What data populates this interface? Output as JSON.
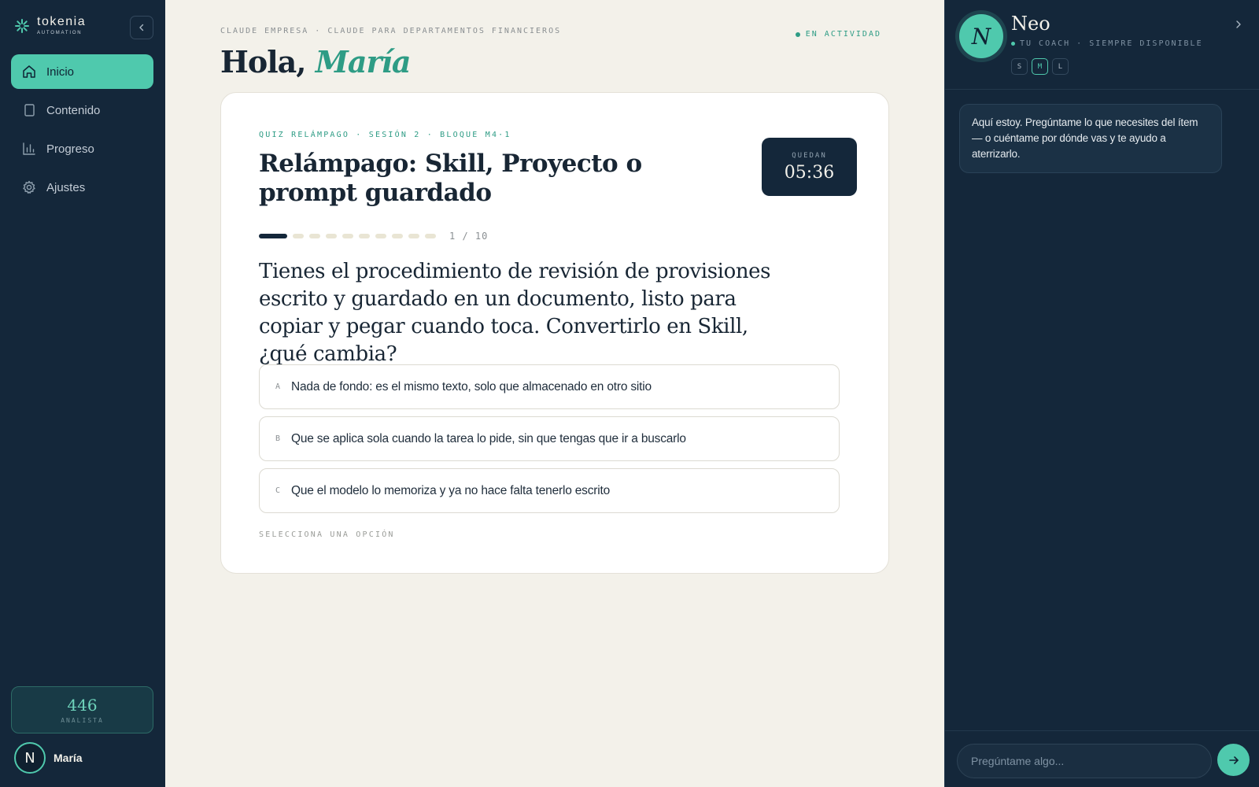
{
  "brand": {
    "name": "tokenia",
    "tagline": "AUTOMATION"
  },
  "sidebar": {
    "items": [
      {
        "label": "Inicio",
        "icon": "home-icon",
        "active": true
      },
      {
        "label": "Contenido",
        "icon": "document-icon"
      },
      {
        "label": "Progreso",
        "icon": "bar-chart-icon"
      },
      {
        "label": "Ajustes",
        "icon": "gear-icon"
      }
    ],
    "score": {
      "value": "446",
      "label": "ANALISTA"
    },
    "user": {
      "initial": "N",
      "name": "María"
    }
  },
  "main": {
    "eyebrow": "CLAUDE EMPRESA · CLAUDE PARA DEPARTAMENTOS FINANCIEROS",
    "status": "EN ACTIVIDAD",
    "greeting_prefix": "Hola,",
    "greeting_name": "María",
    "quiz": {
      "eyebrow": "QUIZ RELÁMPAGO · SESIÓN 2 · BLOQUE M4·1",
      "title": "Relámpago: Skill, Proyecto o prompt guardado",
      "timer_label": "QUEDAN",
      "timer_value": "05:36",
      "progress": {
        "current": 1,
        "total": 10,
        "label": "1 / 10"
      },
      "question": "Tienes el procedimiento de revisión de provisiones escrito y guardado en un documento, listo para copiar y pegar cuando toca. Convertirlo en Skill, ¿qué cambia?",
      "options": [
        {
          "letter": "A",
          "text": "Nada de fondo: es el mismo texto, solo que almacenado en otro sitio"
        },
        {
          "letter": "B",
          "text": "Que se aplica sola cuando la tarea lo pide, sin que tengas que ir a buscarlo"
        },
        {
          "letter": "C",
          "text": "Que el modelo lo memoriza y ya no hace falta tenerlo escrito"
        }
      ],
      "hint": "SELECCIONA UNA OPCIÓN"
    }
  },
  "coach": {
    "avatar_letter": "N",
    "name": "Neo",
    "role": "TU COACH · SIEMPRE DISPONIBLE",
    "sizes": [
      "S",
      "M",
      "L"
    ],
    "active_size": "M",
    "message": "Aquí estoy. Pregúntame lo que necesites del ítem — o cuéntame por dónde vas y te ayudo a aterrizarlo.",
    "input_placeholder": "Pregúntame algo..."
  },
  "colors": {
    "accent": "#4fc9ad",
    "navy": "#14273a",
    "background": "#f3f1ea"
  }
}
